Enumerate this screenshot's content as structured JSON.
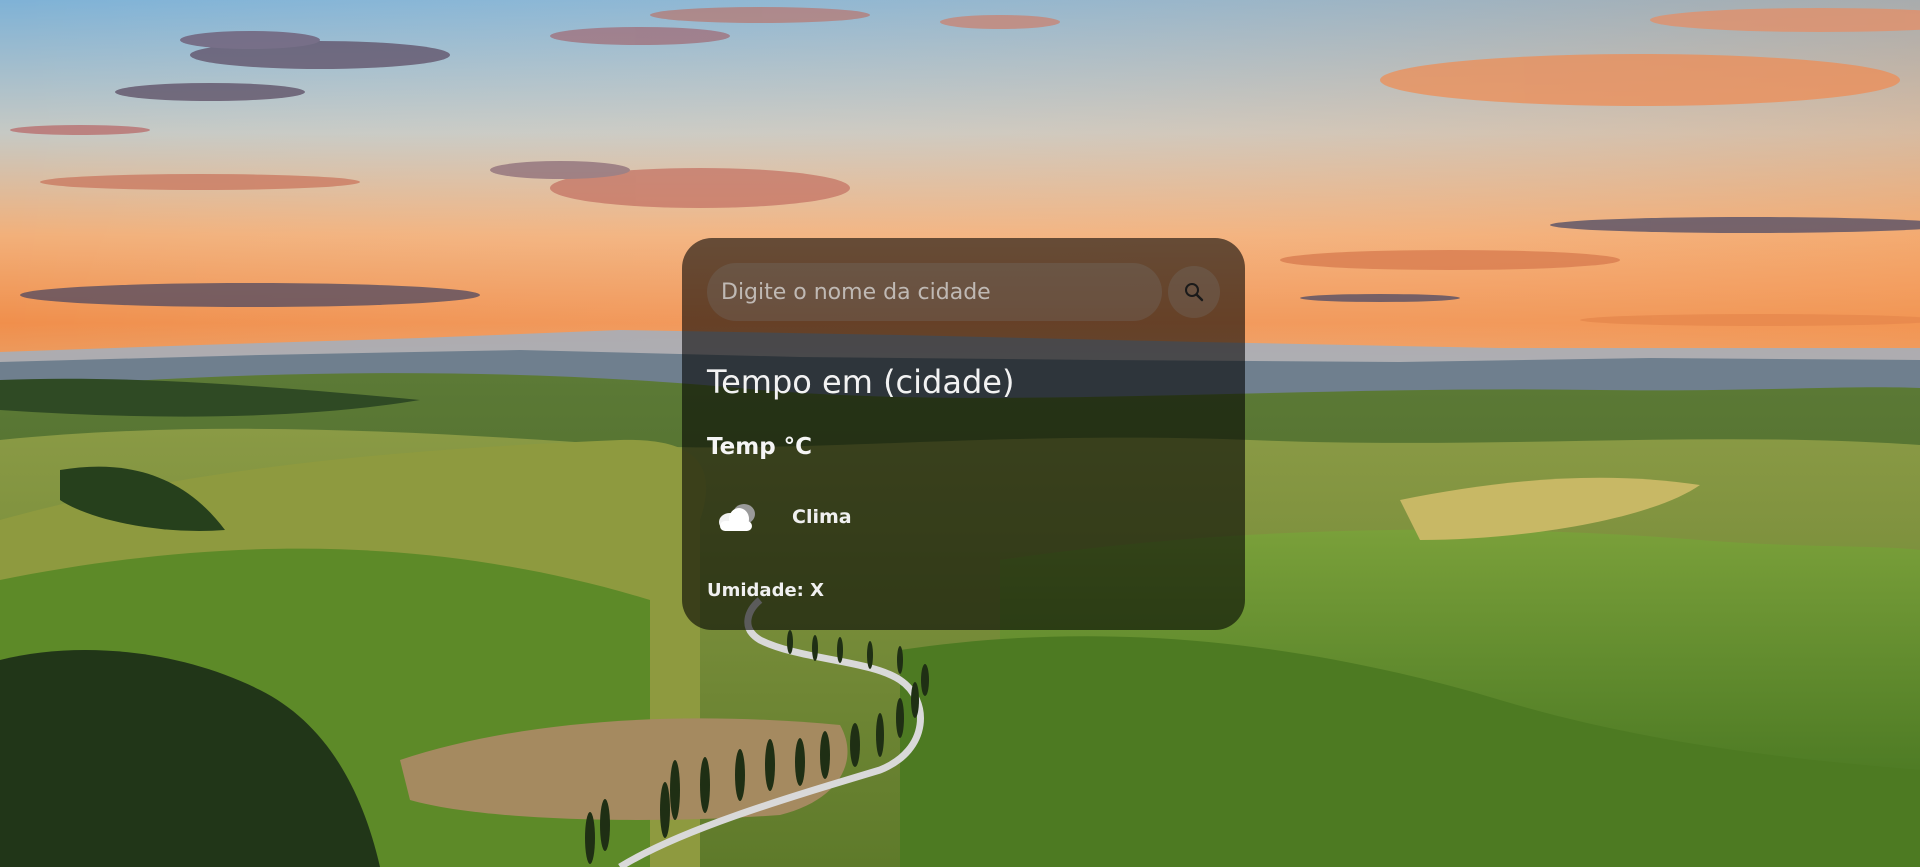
{
  "search": {
    "placeholder": "Digite o nome da cidade",
    "value": ""
  },
  "weather": {
    "title": "Tempo em (cidade)",
    "temperature": "Temp °C",
    "description": "Clima",
    "humidity": "Umidade: X"
  },
  "icons": {
    "search_button": "search-icon",
    "weather": "cloud-icon"
  },
  "colors": {
    "card_background": "rgba(0,0,0,0.58)",
    "text": "#ffffff"
  }
}
